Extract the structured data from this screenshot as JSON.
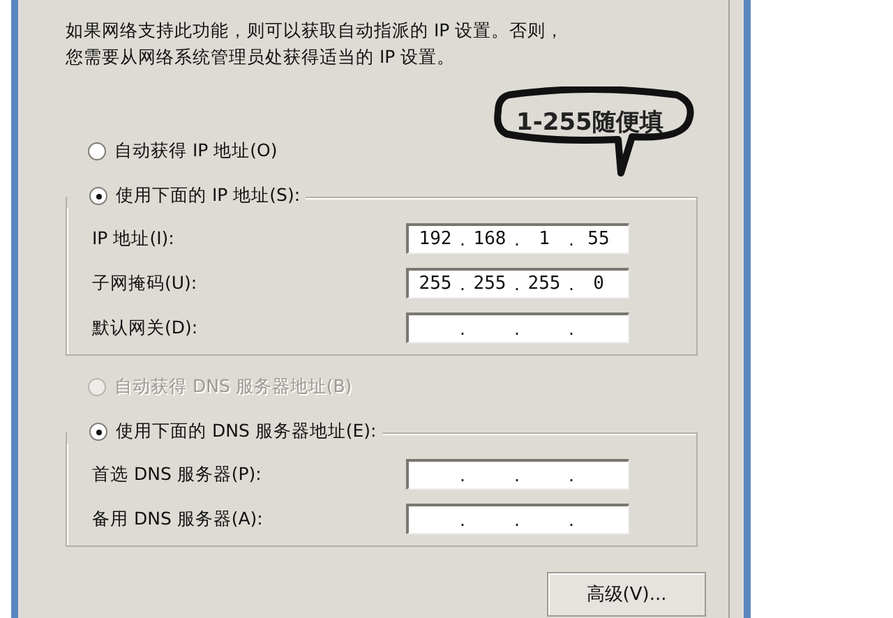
{
  "description": [
    "如果网络支持此功能，则可以获取自动指派的 IP 设置。否则，",
    "您需要从网络系统管理员处获得适当的 IP 设置。"
  ],
  "annotation": {
    "text": "1-255随便填"
  },
  "ip_section": {
    "auto_radio": {
      "label": "自动获得 IP 地址(O)",
      "selected": false,
      "disabled": false
    },
    "manual_radio": {
      "label": "使用下面的 IP 地址(S):",
      "selected": true,
      "disabled": false
    },
    "fields": [
      {
        "label": "IP 地址(I):",
        "octets": [
          "192",
          "168",
          "1",
          "55"
        ],
        "dots": [
          ".",
          ".",
          "."
        ]
      },
      {
        "label": "子网掩码(U):",
        "octets": [
          "255",
          "255",
          "255",
          "0"
        ],
        "dots": [
          ".",
          ".",
          "."
        ]
      },
      {
        "label": "默认网关(D):",
        "dots": [
          ".",
          ".",
          "."
        ]
      }
    ]
  },
  "dns_section": {
    "auto_radio": {
      "label": "自动获得 DNS 服务器地址(B)",
      "selected": false,
      "disabled": true
    },
    "manual_radio": {
      "label": "使用下面的 DNS 服务器地址(E):",
      "selected": true,
      "disabled": false
    },
    "fields": [
      {
        "label": "首选 DNS 服务器(P):",
        "dots": [
          ".",
          ".",
          "."
        ]
      },
      {
        "label": "备用 DNS 服务器(A):",
        "dots": [
          ".",
          ".",
          "."
        ]
      }
    ]
  },
  "buttons": [
    "高级(V)..."
  ]
}
